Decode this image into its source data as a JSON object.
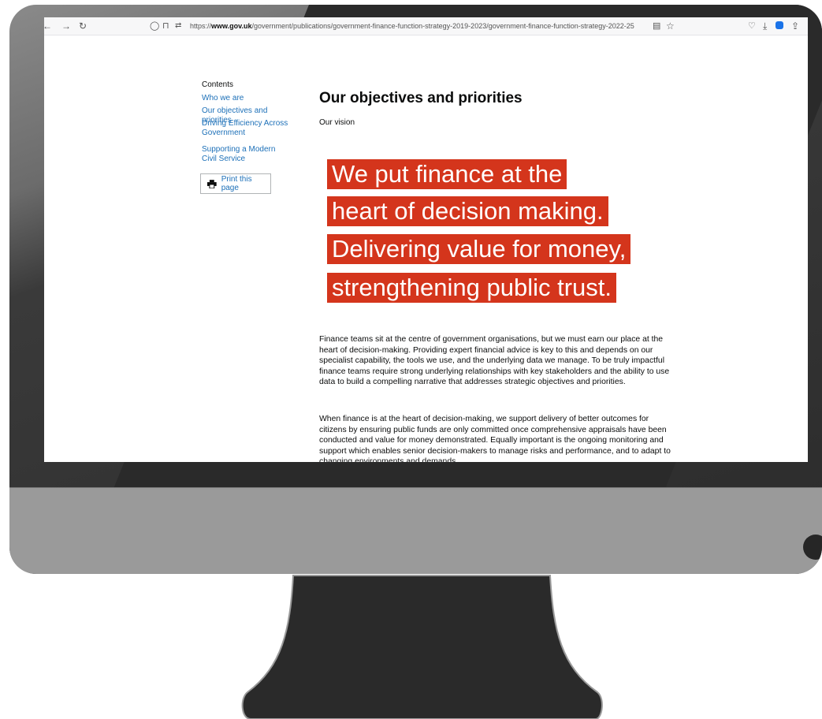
{
  "browser": {
    "url_prefix": "https://",
    "url_domain": "www.gov.uk",
    "url_path": "/government/publications/government-finance-function-strategy-2019-2023/government-finance-function-strategy-2022-25"
  },
  "sidebar": {
    "heading": "Contents",
    "items": [
      {
        "label": "Who we are"
      },
      {
        "label": "Our objectives and priorities"
      },
      {
        "label": "Driving Efficiency Across Government"
      },
      {
        "label": "Supporting a Modern Civil Service"
      }
    ],
    "print_label": "Print this page"
  },
  "main": {
    "title": "Our objectives and priorities",
    "subtitle": "Our vision",
    "banner_lines": [
      "We put finance at the",
      "heart of decision making.",
      "Delivering value for money,",
      "strengthening public trust."
    ],
    "paragraphs": [
      "Finance teams sit at the centre of government organisations, but we must earn our place at the heart of decision-making. Providing expert financial advice is key to this and depends on our specialist capability, the tools we use, and the underlying data we manage. To be truly impactful finance teams require strong underlying relationships with key stakeholders and the ability to use data to build a compelling narrative that addresses strategic objectives and priorities.",
      "When finance is at the heart of decision-making, we support delivery of better outcomes for citizens by ensuring public funds are only committed once comprehensive appraisals have been conducted and value for money demonstrated. Equally important is the ongoing monitoring and support which enables senior decision-makers to manage risks and performance, and to adapt to changing environments and demands."
    ]
  },
  "colors": {
    "banner": "#d4351c",
    "link": "#1d70b8",
    "text": "#0b0c0c"
  }
}
